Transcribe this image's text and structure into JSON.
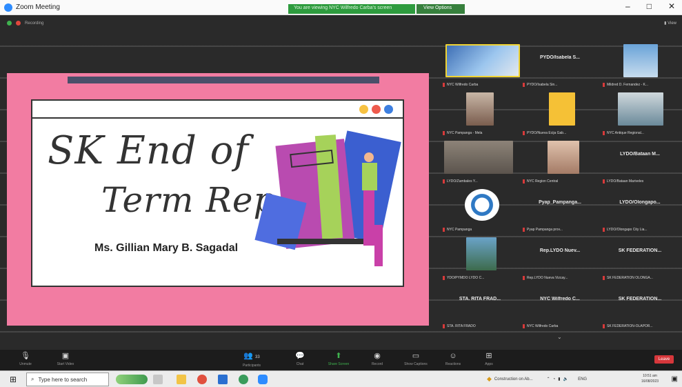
{
  "window": {
    "title": "Zoom Meeting",
    "share_banner": "You are viewing NYC Wilfredo Carba's screen",
    "view_options": "View Options",
    "controls": [
      "–",
      "□",
      "✕"
    ]
  },
  "meeting_top": {
    "status": "Recording",
    "view": "View"
  },
  "slide": {
    "title_line1": "SK End of",
    "title_line2": "Term Report",
    "presenter": "Ms. Gillian Mary B. Sagadal"
  },
  "participants": [
    {
      "label": "NYC Wilfredo Carba",
      "big": ""
    },
    {
      "label": "PYDO/Isabela Sin...",
      "big": "PYDO/Isabela S..."
    },
    {
      "label": "Mildred D. Fernandez - K...",
      "big": ""
    },
    {
      "label": "NYC Pampanga - Mela",
      "big": ""
    },
    {
      "label": "PYDO/Nueva Ecija Gab...",
      "big": ""
    },
    {
      "label": "NYC Antique Regional...",
      "big": ""
    },
    {
      "label": "LYDO/Zambales Y...",
      "big": ""
    },
    {
      "label": "NYC Region Central",
      "big": ""
    },
    {
      "label": "LYDO/Bataan Mariveles",
      "big": "LYDO/Bataan M..."
    },
    {
      "label": "NYC Pampanga",
      "big": ""
    },
    {
      "label": "Pyap Pampanga prov...",
      "big": "Pyap_Pampanga..."
    },
    {
      "label": "LYDO/Olongapo City Lia...",
      "big": "LYDO/Olongapo..."
    },
    {
      "label": "YDO/PYMDO LYDO C...",
      "big": ""
    },
    {
      "label": "Rep.LYDO Nueva Vizcay...",
      "big": "Rep.LYDO Nuev..."
    },
    {
      "label": "SK FEDERATION OLONGA...",
      "big": "SK FEDERATION..."
    },
    {
      "label": "STA. RITA FRADO",
      "big": "STA. RITA FRAD..."
    },
    {
      "label": "NYC Wilfredo Carba",
      "big": "NYC Wilfredo C..."
    },
    {
      "label": "SK FEDERATION-OLAPOR...",
      "big": "SK FEDERATION..."
    }
  ],
  "controls": [
    {
      "icon": "mic",
      "label": "Unmute"
    },
    {
      "icon": "video",
      "label": "Start Video"
    },
    {
      "icon": "participants",
      "label": "Participants",
      "count": "33"
    },
    {
      "icon": "chat",
      "label": "Chat"
    },
    {
      "icon": "share",
      "label": "Share Screen"
    },
    {
      "icon": "record",
      "label": "Record"
    },
    {
      "icon": "captions",
      "label": "Show Captions"
    },
    {
      "icon": "reactions",
      "label": "Reactions"
    },
    {
      "icon": "apps",
      "label": "Apps"
    }
  ],
  "leave_label": "Leave",
  "taskbar": {
    "search_placeholder": "Type here to search",
    "tray_status": "Construction on Ab...",
    "lang": "ENG",
    "time": "10:51 am",
    "date": "16/08/2023"
  },
  "colors": {
    "slide_pink": "#f27ca2",
    "share_green": "#2e9b3e",
    "leave_red": "#d6373b"
  }
}
